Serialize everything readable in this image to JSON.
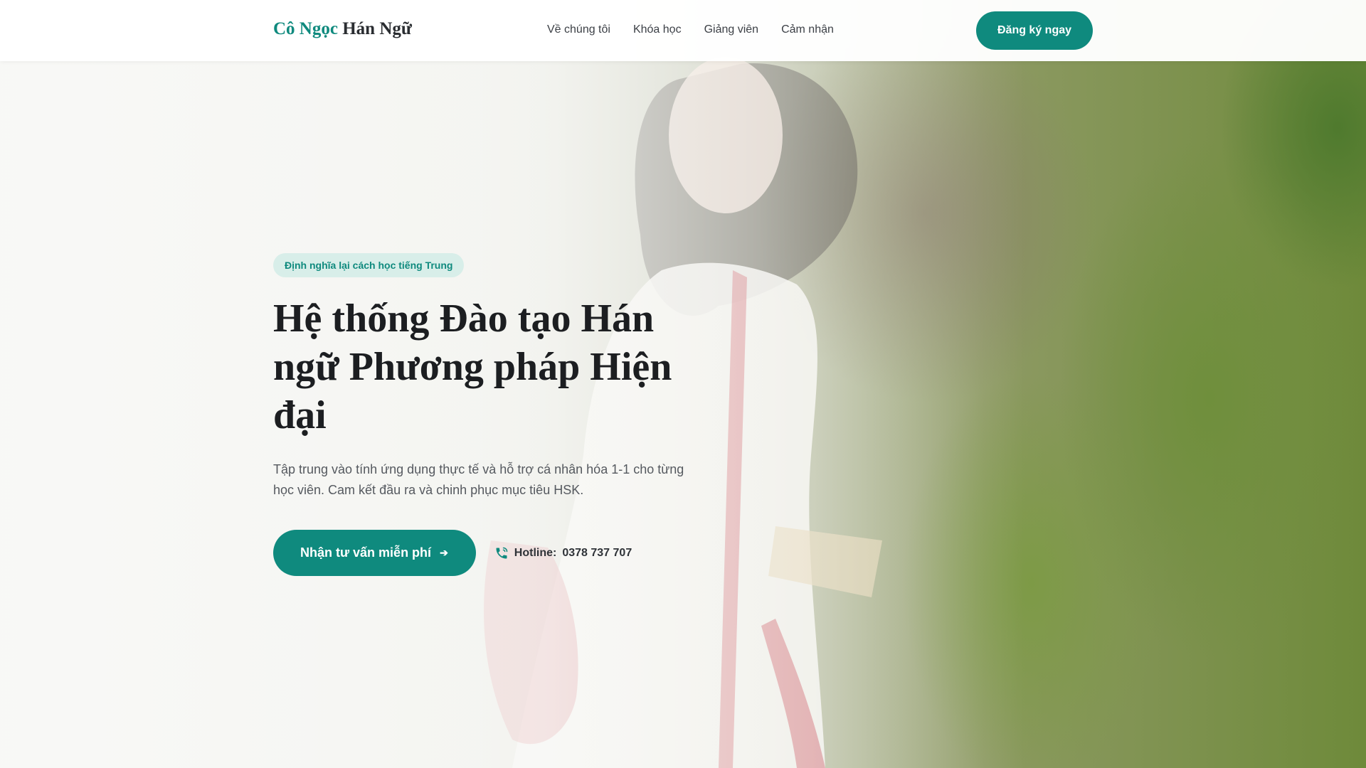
{
  "logo": {
    "accent": "Cô Ngọc",
    "main": "Hán Ngữ"
  },
  "nav": {
    "items": [
      {
        "label": "Về chúng tôi"
      },
      {
        "label": "Khóa học"
      },
      {
        "label": "Giảng viên"
      },
      {
        "label": "Cảm nhận"
      }
    ]
  },
  "header": {
    "cta_label": "Đăng ký ngay"
  },
  "hero": {
    "badge": "Định nghĩa lại cách học tiếng Trung",
    "title": "Hệ thống Đào tạo Hán ngữ Phương pháp Hiện đại",
    "description": "Tập trung vào tính ứng dụng thực tế và hỗ trợ cá nhân hóa 1-1 cho từng học viên. Cam kết đầu ra và chinh phục mục tiêu HSK.",
    "cta_label": "Nhận tư vấn miễn phí",
    "cta_icon": "arrow-right-icon",
    "hotline_label": "Hotline:",
    "hotline_number": "0378 737 707",
    "hotline_icon": "phone-icon"
  },
  "colors": {
    "accent": "#0f8a7e",
    "badge_bg": "#d8eee9",
    "text_dark": "#1c1e21",
    "text_muted": "#55595f"
  }
}
